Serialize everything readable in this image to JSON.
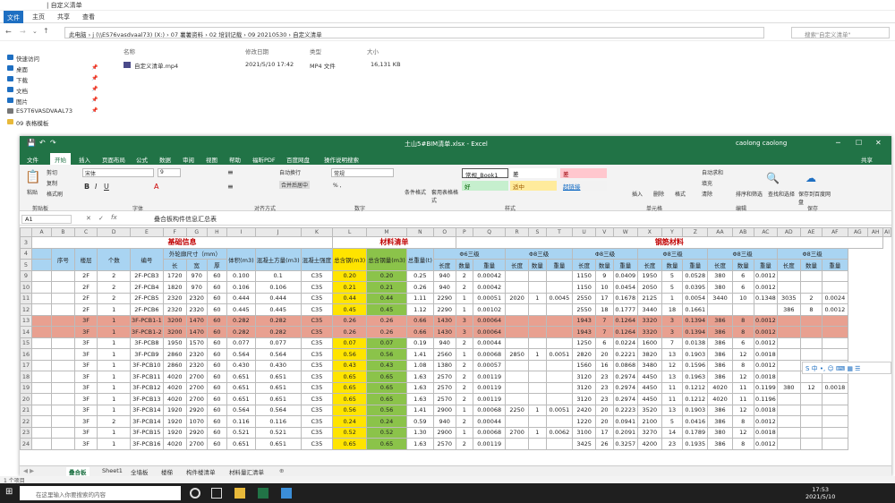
{
  "explorer": {
    "title": "| 自定义清单",
    "tabs": [
      "文件",
      "主页",
      "共享",
      "查看"
    ],
    "address": "此电脑 › j (\\\\ES76vasdvaal73) (X:) › 07 薯薯资料 › 02 培训记载 › 09 20210530 › 自定义清单",
    "search_placeholder": "搜索\"自定义清单\"",
    "nav": [
      {
        "label": "快速访问",
        "pin": false
      },
      {
        "label": "桌面",
        "pin": true
      },
      {
        "label": "下载",
        "pin": true
      },
      {
        "label": "文档",
        "pin": true
      },
      {
        "label": "图片",
        "pin": true
      },
      {
        "label": "ES7T6VASDVAAL73",
        "pin": true
      },
      {
        "label": "09 表格模板",
        "pin": false
      }
    ],
    "columns": [
      "名称",
      "修改日期",
      "类型",
      "大小"
    ],
    "file": {
      "name": "自定义清单.mp4",
      "modified": "2021/5/10 17:42",
      "type": "MP4 文件",
      "size": "16,131 KB"
    }
  },
  "excel": {
    "doc_title": "土山5#BIM清单.xlsx  -  Excel",
    "user": "caolong caolong",
    "tabs": [
      "文件",
      "开始",
      "插入",
      "页面布局",
      "公式",
      "数据",
      "审阅",
      "视图",
      "帮助",
      "福昕PDF",
      "百度网盘",
      "操作说明搜索"
    ],
    "share": "共享",
    "ribbon": {
      "paste": "粘贴",
      "cut": "剪切",
      "copy": "复制",
      "format_painter": "格式刷",
      "font_name": "宋体",
      "font_size": "9",
      "wrap": "自动换行",
      "merge": "合并后居中",
      "number_format": "常规",
      "cond_format": "条件格式",
      "table_format": "套用表格格式",
      "style_common": "常规_Book1",
      "style_bad": "差",
      "style_good": "好",
      "style_neutral": "适中",
      "style_calc": "计算",
      "style_check": "超链接",
      "insert": "插入",
      "delete": "删除",
      "format": "格式",
      "autosum": "自动求和",
      "fill": "填充",
      "clear": "清除",
      "sort": "排序和筛选",
      "find": "查找和选择",
      "save": "保存到百度网盘",
      "groups": [
        "剪贴板",
        "字体",
        "对齐方式",
        "数字",
        "样式",
        "单元格",
        "编辑",
        "保存"
      ]
    },
    "name_box": "A1",
    "formula": "叠合板构件信息汇总表",
    "col_headers": [
      "A",
      "B",
      "C",
      "D",
      "E",
      "F",
      "G",
      "H",
      "I",
      "J",
      "K",
      "L",
      "M",
      "N",
      "O",
      "P",
      "Q",
      "R",
      "S",
      "T",
      "U",
      "V",
      "W",
      "X",
      "Y",
      "Z",
      "AA",
      "AB",
      "AC",
      "AD",
      "AE",
      "AF",
      "AG",
      "AH",
      "AI"
    ],
    "sections": {
      "basic": "基础信息",
      "material": "材料清单",
      "rebar": "钢筋材料"
    },
    "headers": {
      "seq": "序号",
      "floor": "楼层",
      "count": "个数",
      "code": "编号",
      "dims": "外轮廓尺寸（mm）",
      "len": "长",
      "wid": "宽",
      "thk": "厚",
      "vol": "体积(m3)",
      "total_vol": "混凝土方量(m3)",
      "concrete_grade": "混凝土强度",
      "steel": "总含钢(m3)",
      "total_steel": "总含钢量(m3)",
      "weight": "总重量(t)"
    },
    "rebar_groups": [
      "Φ6三级",
      "Φ8三级",
      "Φ8三级",
      "Φ8三级",
      "Φ8三级",
      "Φ8三级"
    ],
    "rebar_cols": [
      "长度",
      "数量",
      "重量"
    ],
    "rows": [
      {
        "r": "9",
        "floor": "2F",
        "n": "2",
        "code": "2F-PCB3",
        "L": "1720",
        "W": "970",
        "T": "60",
        "v": "0.100",
        "tv": "0.1",
        "g": "C35",
        "s": "0.20",
        "ts": "0.20",
        "wt": "0.25",
        "c": [
          "940",
          "2",
          "0.00042",
          "",
          "",
          "",
          "1150",
          "9",
          "0.0409",
          "1950",
          "5",
          "0.0528",
          "380",
          "6",
          "0.0012",
          "",
          "",
          ""
        ],
        "pink": false
      },
      {
        "r": "10",
        "floor": "2F",
        "n": "2",
        "code": "2F-PCB4",
        "L": "1820",
        "W": "970",
        "T": "60",
        "v": "0.106",
        "tv": "0.106",
        "g": "C35",
        "s": "0.21",
        "ts": "0.21",
        "wt": "0.26",
        "c": [
          "940",
          "2",
          "0.00042",
          "",
          "",
          "",
          "1150",
          "10",
          "0.0454",
          "2050",
          "5",
          "0.0395",
          "380",
          "6",
          "0.0012",
          "",
          "",
          ""
        ],
        "pink": false
      },
      {
        "r": "11",
        "floor": "2F",
        "n": "2",
        "code": "2F-PCB5",
        "L": "2320",
        "W": "2320",
        "T": "60",
        "v": "0.444",
        "tv": "0.444",
        "g": "C35",
        "s": "0.44",
        "ts": "0.44",
        "wt": "1.11",
        "c": [
          "2290",
          "1",
          "0.00051",
          "2020",
          "1",
          "0.0045",
          "2550",
          "17",
          "0.1678",
          "2125",
          "1",
          "0.0054",
          "3440",
          "10",
          "0.1348",
          "3035",
          "2",
          "0.0024"
        ],
        "pink": false
      },
      {
        "r": "12",
        "floor": "2F",
        "n": "1",
        "code": "2F-PCB6",
        "L": "2320",
        "W": "2320",
        "T": "60",
        "v": "0.445",
        "tv": "0.445",
        "g": "C35",
        "s": "0.45",
        "ts": "0.45",
        "wt": "1.12",
        "c": [
          "2290",
          "1",
          "0.00102",
          "",
          "",
          "",
          "2550",
          "18",
          "0.1777",
          "3440",
          "18",
          "0.1661",
          "",
          "",
          "",
          "386",
          "8",
          "0.0012"
        ],
        "pink": false
      },
      {
        "r": "13",
        "floor": "3F",
        "n": "1",
        "code": "3F-PCB1-1",
        "L": "3200",
        "W": "1470",
        "T": "60",
        "v": "0.282",
        "tv": "0.282",
        "g": "C35",
        "s": "0.26",
        "ts": "0.26",
        "wt": "0.66",
        "c": [
          "1430",
          "3",
          "0.00064",
          "",
          "",
          "",
          "1943",
          "7",
          "0.1264",
          "3320",
          "3",
          "0.1394",
          "386",
          "8",
          "0.0012",
          "",
          "",
          ""
        ],
        "pink": true
      },
      {
        "r": "14",
        "floor": "3F",
        "n": "1",
        "code": "3F-PCB1-2",
        "L": "3200",
        "W": "1470",
        "T": "60",
        "v": "0.282",
        "tv": "0.282",
        "g": "C35",
        "s": "0.26",
        "ts": "0.26",
        "wt": "0.66",
        "c": [
          "1430",
          "3",
          "0.00064",
          "",
          "",
          "",
          "1943",
          "7",
          "0.1264",
          "3320",
          "3",
          "0.1394",
          "386",
          "8",
          "0.0012",
          "",
          "",
          ""
        ],
        "pink": true
      },
      {
        "r": "15",
        "floor": "3F",
        "n": "1",
        "code": "3F-PCB8",
        "L": "1950",
        "W": "1570",
        "T": "60",
        "v": "0.077",
        "tv": "0.077",
        "g": "C35",
        "s": "0.07",
        "ts": "0.07",
        "wt": "0.19",
        "c": [
          "940",
          "2",
          "0.00044",
          "",
          "",
          "",
          "1250",
          "6",
          "0.0224",
          "1600",
          "7",
          "0.0138",
          "386",
          "6",
          "0.0012",
          "",
          "",
          ""
        ],
        "pink": false
      },
      {
        "r": "16",
        "floor": "3F",
        "n": "1",
        "code": "3F-PCB9",
        "L": "2860",
        "W": "2320",
        "T": "60",
        "v": "0.564",
        "tv": "0.564",
        "g": "C35",
        "s": "0.56",
        "ts": "0.56",
        "wt": "1.41",
        "c": [
          "2560",
          "1",
          "0.00068",
          "2850",
          "1",
          "0.0051",
          "2820",
          "20",
          "0.2221",
          "3820",
          "13",
          "0.1903",
          "386",
          "12",
          "0.0018",
          "",
          "",
          ""
        ],
        "pink": false
      },
      {
        "r": "17",
        "floor": "3F",
        "n": "1",
        "code": "3F-PCB10",
        "L": "2860",
        "W": "2320",
        "T": "60",
        "v": "0.430",
        "tv": "0.430",
        "g": "C35",
        "s": "0.43",
        "ts": "0.43",
        "wt": "1.08",
        "c": [
          "1380",
          "2",
          "0.00057",
          "",
          "",
          "",
          "1560",
          "16",
          "0.0868",
          "3480",
          "12",
          "0.1596",
          "386",
          "8",
          "0.0012",
          "",
          "",
          ""
        ],
        "pink": false
      },
      {
        "r": "18",
        "floor": "3F",
        "n": "1",
        "code": "3F-PCB11",
        "L": "4020",
        "W": "2700",
        "T": "60",
        "v": "0.651",
        "tv": "0.651",
        "g": "C35",
        "s": "0.65",
        "ts": "0.65",
        "wt": "1.63",
        "c": [
          "2570",
          "2",
          "0.00119",
          "",
          "",
          "",
          "3120",
          "23",
          "0.2974",
          "4450",
          "13",
          "0.1963",
          "386",
          "12",
          "0.0018",
          "",
          "",
          ""
        ],
        "pink": false
      },
      {
        "r": "19",
        "floor": "3F",
        "n": "1",
        "code": "3F-PCB12",
        "L": "4020",
        "W": "2700",
        "T": "60",
        "v": "0.651",
        "tv": "0.651",
        "g": "C35",
        "s": "0.65",
        "ts": "0.65",
        "wt": "1.63",
        "c": [
          "2570",
          "2",
          "0.00119",
          "",
          "",
          "",
          "3120",
          "23",
          "0.2974",
          "4450",
          "11",
          "0.1212",
          "4020",
          "11",
          "0.1199",
          "380",
          "12",
          "0.0018"
        ],
        "pink": false
      },
      {
        "r": "20",
        "floor": "3F",
        "n": "1",
        "code": "3F-PCB13",
        "L": "4020",
        "W": "2700",
        "T": "60",
        "v": "0.651",
        "tv": "0.651",
        "g": "C35",
        "s": "0.65",
        "ts": "0.65",
        "wt": "1.63",
        "c": [
          "2570",
          "2",
          "0.00119",
          "",
          "",
          "",
          "3120",
          "23",
          "0.2974",
          "4450",
          "11",
          "0.1212",
          "4020",
          "11",
          "0.1196",
          "",
          "",
          ""
        ],
        "pink": false
      },
      {
        "r": "21",
        "floor": "3F",
        "n": "1",
        "code": "3F-PCB14",
        "L": "1920",
        "W": "2920",
        "T": "60",
        "v": "0.564",
        "tv": "0.564",
        "g": "C35",
        "s": "0.56",
        "ts": "0.56",
        "wt": "1.41",
        "c": [
          "2900",
          "1",
          "0.00068",
          "2250",
          "1",
          "0.0051",
          "2420",
          "20",
          "0.2223",
          "3520",
          "13",
          "0.1903",
          "386",
          "12",
          "0.0018",
          "",
          "",
          ""
        ],
        "pink": false
      },
      {
        "r": "22",
        "floor": "3F",
        "n": "2",
        "code": "3F-PCB14",
        "L": "1920",
        "W": "1070",
        "T": "60",
        "v": "0.116",
        "tv": "0.116",
        "g": "C35",
        "s": "0.24",
        "ts": "0.24",
        "wt": "0.59",
        "c": [
          "940",
          "2",
          "0.00044",
          "",
          "",
          "",
          "1220",
          "20",
          "0.0941",
          "2100",
          "5",
          "0.0416",
          "386",
          "8",
          "0.0012",
          "",
          "",
          ""
        ],
        "pink": false
      },
      {
        "r": "23",
        "floor": "3F",
        "n": "1",
        "code": "3F-PCB15",
        "L": "1920",
        "W": "2920",
        "T": "60",
        "v": "0.521",
        "tv": "0.521",
        "g": "C35",
        "s": "0.52",
        "ts": "0.52",
        "wt": "1.30",
        "c": [
          "2900",
          "1",
          "0.00068",
          "2700",
          "1",
          "0.0062",
          "3100",
          "17",
          "0.2091",
          "3270",
          "14",
          "0.1789",
          "380",
          "12",
          "0.0018",
          "",
          "",
          ""
        ],
        "pink": false
      },
      {
        "r": "24",
        "floor": "3F",
        "n": "1",
        "code": "3F-PCB16",
        "L": "4020",
        "W": "2700",
        "T": "60",
        "v": "0.651",
        "tv": "0.651",
        "g": "C35",
        "s": "0.65",
        "ts": "0.65",
        "wt": "1.63",
        "c": [
          "2570",
          "2",
          "0.00119",
          "",
          "",
          "",
          "3425",
          "26",
          "0.3257",
          "4200",
          "23",
          "0.1935",
          "386",
          "8",
          "0.0012",
          "",
          "",
          ""
        ],
        "pink": false
      }
    ],
    "sheet_tabs": [
      "叠合板",
      "Sheet1",
      "全墙板",
      "楼梯",
      "构件楼清单",
      "材料量汇清单"
    ],
    "status": "1 个项目"
  },
  "ime": "S 中 •, ☺ ⌨ ▦ ☰",
  "taskbar": {
    "search": "在这里输入你要搜索的内容",
    "time": "17:53",
    "date": "2021/5/10"
  }
}
